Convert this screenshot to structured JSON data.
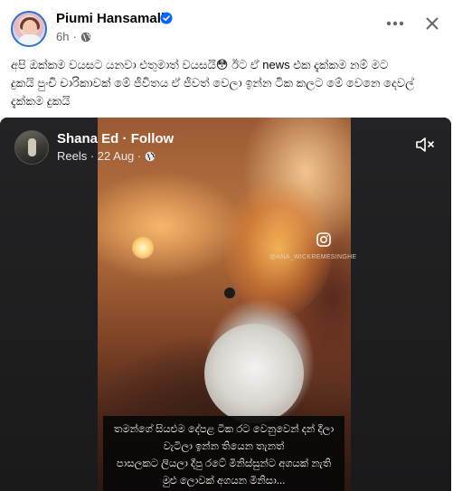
{
  "post": {
    "author": "Piumi Hansamali",
    "time": "6h",
    "text_lines": [
      "අපි ඔක්කම වයසට යනවා එතුමාත් වයසයි😳 ඊට ඒ news එක දැක්කම නම් මට",
      "දුකයි පුංචි චාරිකාවක් මේ ජීවිතය ඒ ජීවත් වෙලා ඉන්න ටික කලට මේ වෙනෙ දෙවල්",
      "දැක්කම දුකයි"
    ]
  },
  "shared": {
    "name": "Shana Ed",
    "separator": "·",
    "follow": "Follow",
    "meta": "Reels · 22 Aug ·",
    "watermark": "@ANA_WICKREMESINGHE",
    "caption_lines": [
      "තමන්ගේ සියළුම දේපළ ටික රට වෙනුවෙන් දන් දීලා",
      "වැටිලා ඉන්න තියෙන තැනත්",
      "පාසලකට ලියලා දීපු රටේ මිනිස්සුන්ට අගයක් නැති",
      "මුළු ලොවක් අගයන මිනිසා..."
    ]
  },
  "icons": {
    "verified": "verified-badge-icon",
    "privacy": "globe-icon",
    "more": "more-options-icon",
    "close": "close-icon",
    "mute": "mute-icon",
    "instagram": "instagram-icon"
  },
  "colors": {
    "accent": "#0866ff",
    "muted_text": "#65676b",
    "card_bg": "#1c1c1d"
  }
}
